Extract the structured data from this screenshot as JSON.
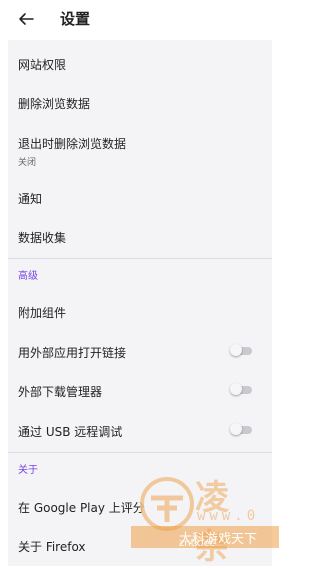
{
  "header": {
    "back_icon": "arrow-left-icon",
    "title": "设置"
  },
  "general": {
    "site_permissions": "网站权限",
    "delete_browsing_data": "删除浏览数据",
    "delete_on_quit": "退出时删除浏览数据",
    "delete_on_quit_value": "关闭",
    "notifications": "通知",
    "data_collection": "数据收集"
  },
  "advanced": {
    "section_label": "高级",
    "addons": "附加组件",
    "open_links_in_apps": {
      "label": "用外部应用打开链接",
      "enabled": false
    },
    "external_download_manager": {
      "label": "外部下载管理器",
      "enabled": false
    },
    "remote_debugging_usb": {
      "label": "通过 USB 远程调试",
      "enabled": false
    }
  },
  "about": {
    "section_label": "关于",
    "rate_on_google_play": "在 Google Play 上评分",
    "about_firefox": "关于 Firefox"
  },
  "watermark": {
    "brand": "凌 杂",
    "url_large": "www.0",
    "tagline": "大科游戏天下",
    "url_small": "zntx.cc"
  },
  "colors": {
    "accent": "#7542e5",
    "panel_bg": "#f4f4f7",
    "toggle_off": "#c9c9d0"
  }
}
